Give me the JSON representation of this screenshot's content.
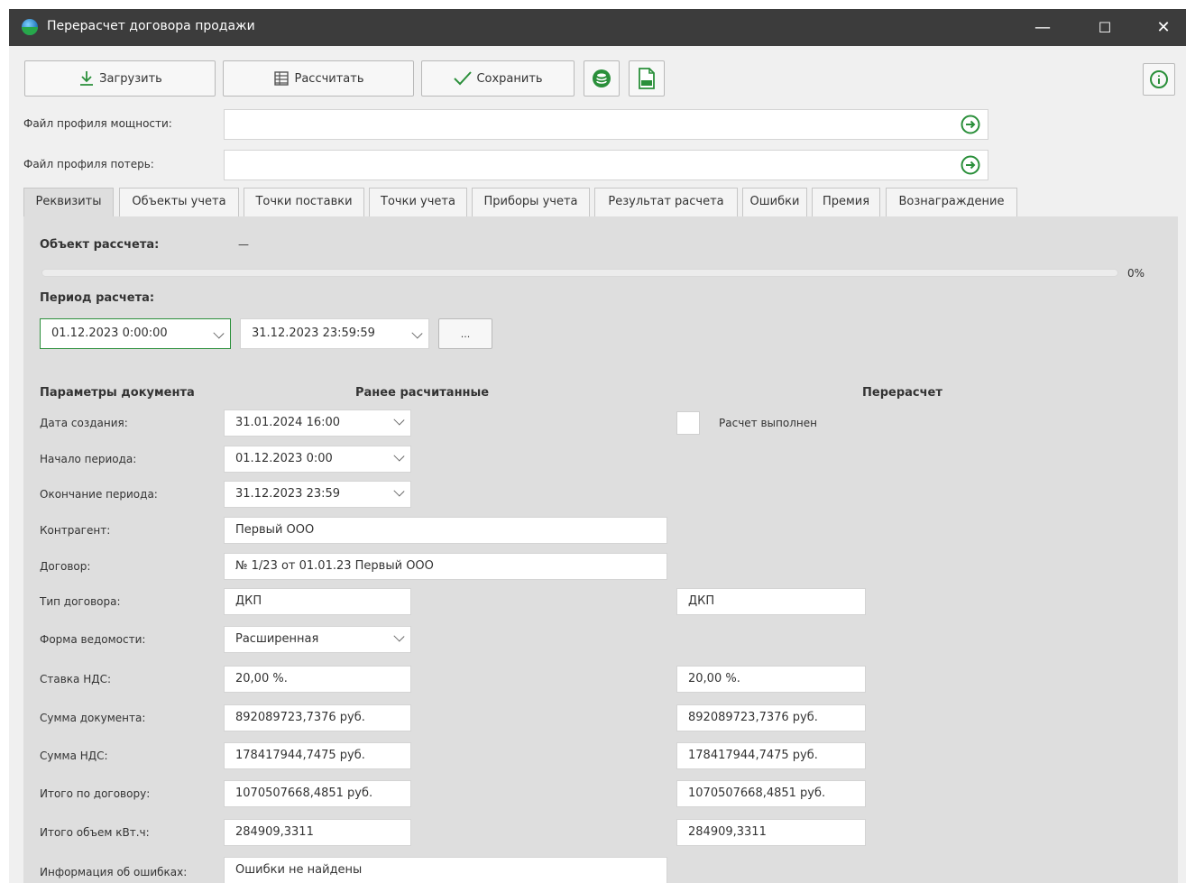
{
  "window": {
    "title": "Перерасчет договора продажи",
    "minimize": "—",
    "maximize": "☐",
    "close": "✕"
  },
  "toolbar": {
    "load_label": "Загрузить",
    "calc_label": "Рассчитать",
    "save_label": "Сохранить"
  },
  "files": {
    "power_label": "Файл профиля мощности:",
    "power_value": "",
    "loss_label": "Файл профиля потерь:",
    "loss_value": ""
  },
  "tabs": [
    "Реквизиты",
    "Объекты учета",
    "Точки поставки",
    "Точки учета",
    "Приборы учета",
    "Результат расчета",
    "Ошибки",
    "Премия",
    "Вознаграждение"
  ],
  "calc": {
    "object_label": "Объект рассчета:",
    "object_value": "—",
    "progress_percent": 0,
    "progress_text": "0%",
    "period_label": "Период расчета:",
    "period_from": "01.12.2023 0:00:00",
    "period_to": "31.12.2023 23:59:59",
    "period_more": "..."
  },
  "headers": {
    "params": "Параметры документа",
    "previous": "Ранее расчитанные",
    "recalc": "Перерасчет"
  },
  "recalc_done_label": "Расчет выполнен",
  "rows": {
    "created": {
      "label": "Дата создания:",
      "prev": "31.01.2024 16:00"
    },
    "start": {
      "label": "Начало периода:",
      "prev": "01.12.2023 0:00"
    },
    "end": {
      "label": "Окончание периода:",
      "prev": "31.12.2023 23:59"
    },
    "counterparty": {
      "label": "Контрагент:",
      "prev": "Первый ООО"
    },
    "contract": {
      "label": "Договор:",
      "prev": "№ 1/23 от 01.01.23 Первый ООО"
    },
    "contract_type": {
      "label": "Тип договора:",
      "prev": "ДКП",
      "recalc": "ДКП"
    },
    "form": {
      "label": "Форма ведомости:",
      "prev": "Расширенная"
    },
    "vat_rate": {
      "label": "Ставка НДС:",
      "prev": "20,00 %.",
      "recalc": "20,00 %."
    },
    "doc_sum": {
      "label": "Сумма документа:",
      "prev": "892089723,7376 руб.",
      "recalc": "892089723,7376 руб."
    },
    "vat_sum": {
      "label": "Сумма НДС:",
      "prev": "178417944,7475 руб.",
      "recalc": "178417944,7475 руб."
    },
    "total": {
      "label": "Итого по договору:",
      "prev": "1070507668,4851 руб.",
      "recalc": "1070507668,4851 руб."
    },
    "kwh": {
      "label": "Итого объем кВт.ч:",
      "prev": "284909,3311",
      "recalc": "284909,3311"
    },
    "errors": {
      "label": "Информация об ошибках:",
      "prev": "Ошибки не найдены"
    }
  },
  "colors": {
    "accent": "#2a8f3a",
    "titlebar": "#3c3c3c"
  }
}
